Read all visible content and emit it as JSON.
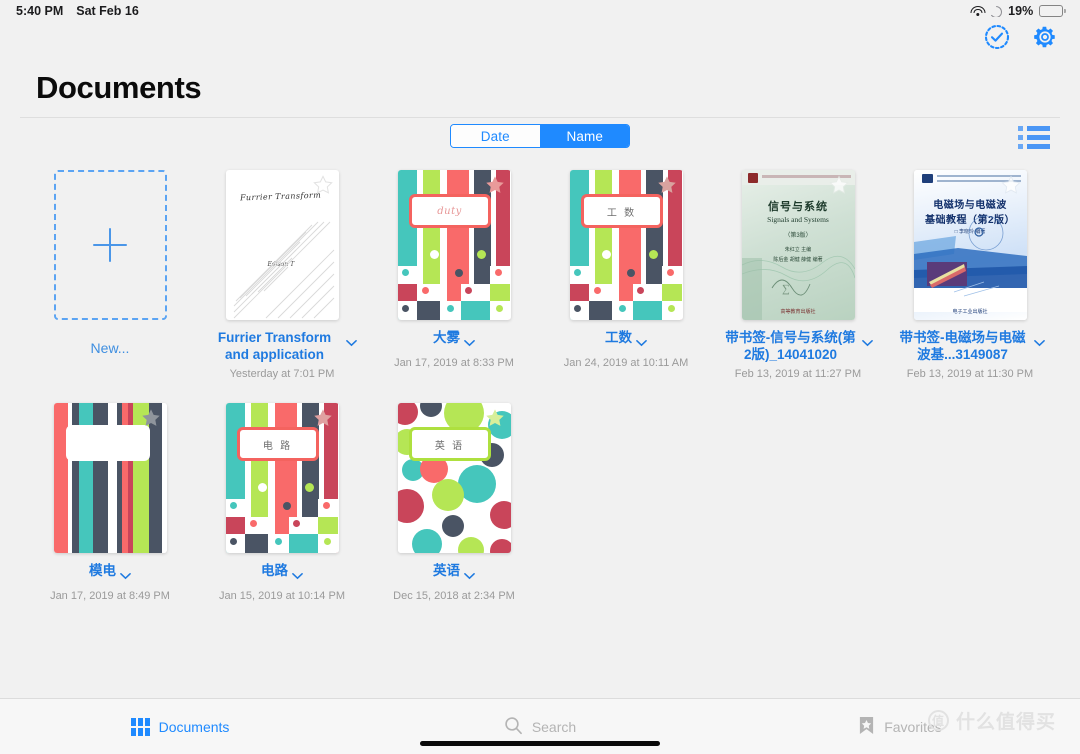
{
  "status_bar": {
    "time": "5:40 PM",
    "date": "Sat Feb 16",
    "battery_percent": "19%",
    "battery_level": 19,
    "wifi_icon": "wifi-icon",
    "dnd_icon": "moon-icon"
  },
  "top_actions": {
    "select_icon": "dashed-check-circle-icon",
    "settings_icon": "gear-icon",
    "accent": "#1f8aff"
  },
  "header": {
    "title": "Documents"
  },
  "sort": {
    "options": [
      "Date",
      "Name"
    ],
    "selected": "Name",
    "list_view_icon": "list-view-icon"
  },
  "new_item": {
    "label": "New...",
    "plus_icon": "plus-icon"
  },
  "documents": [
    {
      "title": "Furrier Transform and application",
      "date": "Yesterday at 7:01 PM",
      "thumb": "paper",
      "star": "outline",
      "cover_text": "Furrier Transform",
      "cover_subtext": "Edison T",
      "chevron_icon": "chevron-down-icon"
    },
    {
      "title": "大雾",
      "date": "Jan 17, 2019 at 8:33 PM",
      "thumb": "stripes-dots",
      "star": "pink",
      "cover_text": "duty",
      "label_border": "#f4635f",
      "chevron_icon": "chevron-down-icon"
    },
    {
      "title": "工数",
      "date": "Jan 24, 2019 at 10:11 AM",
      "thumb": "stripes-dots",
      "star": "pink",
      "cover_text": "工 数",
      "label_border": "#f4635f",
      "chevron_icon": "chevron-down-icon"
    },
    {
      "title": "带书签-信号与系统(第2版)_14041020",
      "date": "Feb 13, 2019 at 11:27 PM",
      "thumb": "book-green",
      "star": "outline",
      "cover_title_cn": "信号与系统",
      "cover_title_en": "Signals and Systems",
      "cover_edition": "（第3版）",
      "chevron_icon": "chevron-down-icon"
    },
    {
      "title": "带书签-电磁场与电磁波基...3149087",
      "date": "Feb 13, 2019 at 11:30 PM",
      "thumb": "book-blue",
      "star": "outline",
      "cover_title_cn": "电磁场与电磁波",
      "cover_title_cn2": "基础教程（第2版）",
      "chevron_icon": "chevron-down-icon"
    },
    {
      "title": "模电",
      "date": "Jan 17, 2019 at 8:49 PM",
      "thumb": "stripes-plain",
      "star": "gray",
      "cover_text": "",
      "label_border": "#ffffff",
      "chevron_icon": "chevron-down-icon"
    },
    {
      "title": "电路",
      "date": "Jan 15, 2019 at 10:14 PM",
      "thumb": "stripes-dots",
      "star": "pink",
      "cover_text": "电 路",
      "label_border": "#f4635f",
      "chevron_icon": "chevron-down-icon"
    },
    {
      "title": "英语",
      "date": "Dec 15, 2018 at 2:34 PM",
      "thumb": "polka",
      "star": "green",
      "cover_text": "英 语",
      "label_border": "#aee03f",
      "chevron_icon": "chevron-down-icon"
    }
  ],
  "palette": {
    "teal": "#45c6bc",
    "lime": "#b5e655",
    "coral": "#f96a6a",
    "slate": "#4a5464",
    "crimson": "#c9455a",
    "blue": "#1f8aff",
    "background": "#f1f1f1"
  },
  "tabbar": {
    "tabs": [
      {
        "label": "Documents",
        "icon": "grid-icon",
        "active": true
      },
      {
        "label": "Search",
        "icon": "search-icon",
        "active": false
      },
      {
        "label": "Favorites",
        "icon": "bookmark-star-icon",
        "active": false
      }
    ]
  },
  "watermark": {
    "mark": "值",
    "text": "什么值得买"
  }
}
